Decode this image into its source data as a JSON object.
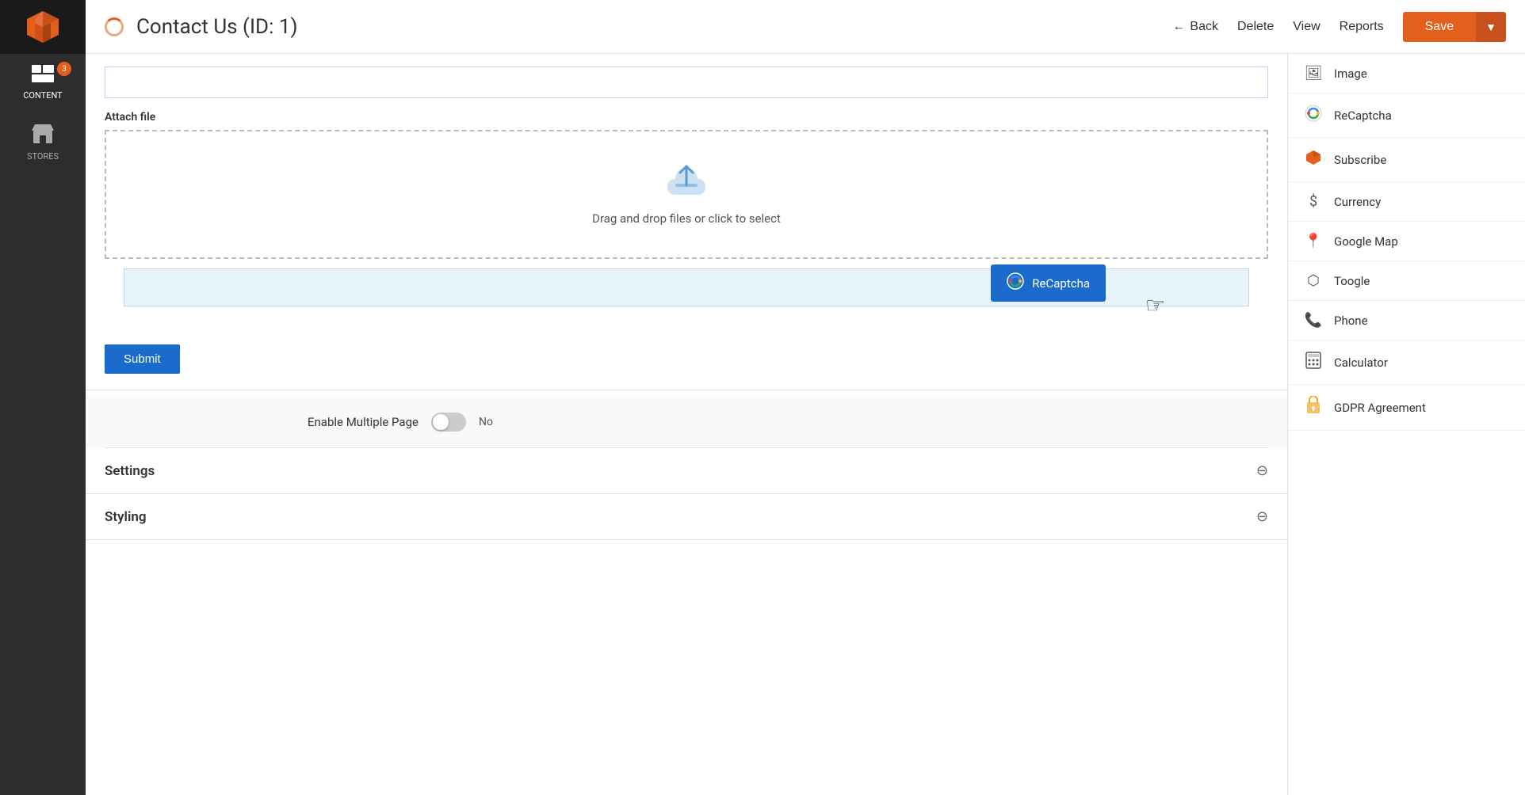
{
  "sidebar": {
    "logo_alt": "Magento Logo",
    "items": [
      {
        "id": "content",
        "label": "CONTENT",
        "badge": 3,
        "active": true
      },
      {
        "id": "stores",
        "label": "STORES",
        "badge": null,
        "active": false
      }
    ]
  },
  "header": {
    "title": "Contact Us (ID: 1)",
    "back_label": "Back",
    "delete_label": "Delete",
    "view_label": "View",
    "reports_label": "Reports",
    "save_label": "Save"
  },
  "form": {
    "attach_label": "Attach file",
    "dropzone_text": "Drag and drop files or click to select",
    "recaptcha_tooltip": "ReCaptcha",
    "submit_label": "Submit",
    "enable_multiple_page_label": "Enable Multiple Page",
    "toggle_state": "No"
  },
  "collapsible_sections": [
    {
      "id": "settings",
      "label": "Settings"
    },
    {
      "id": "styling",
      "label": "Styling"
    }
  ],
  "right_sidebar": {
    "widgets": [
      {
        "id": "image",
        "label": "Image",
        "icon": "image"
      },
      {
        "id": "recaptcha",
        "label": "ReCaptcha",
        "icon": "recaptcha"
      },
      {
        "id": "subscribe",
        "label": "Subscribe",
        "icon": "subscribe"
      },
      {
        "id": "currency",
        "label": "Currency",
        "icon": "currency"
      },
      {
        "id": "google_map",
        "label": "Google Map",
        "icon": "map"
      },
      {
        "id": "toogle",
        "label": "Toogle",
        "icon": "toggle"
      },
      {
        "id": "phone",
        "label": "Phone",
        "icon": "phone"
      },
      {
        "id": "calculator",
        "label": "Calculator",
        "icon": "calculator"
      },
      {
        "id": "gdpr",
        "label": "GDPR Agreement",
        "icon": "gdpr"
      }
    ]
  }
}
